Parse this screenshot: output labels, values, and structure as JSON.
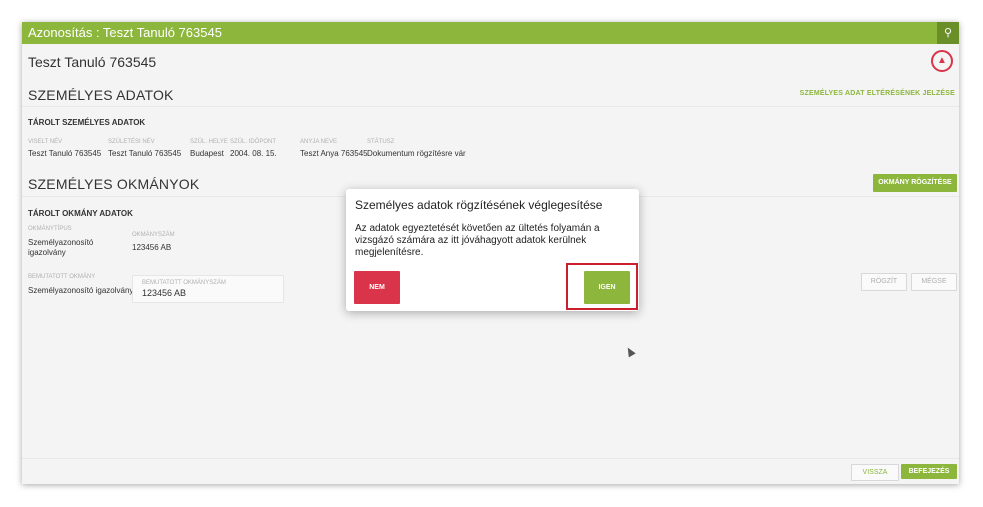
{
  "header": {
    "title": "Azonosítás : Teszt Tanuló 763545",
    "search_icon": "search-icon"
  },
  "student_name": "Teszt Tanuló 763545",
  "personal": {
    "title": "SZEMÉLYES ADATOK",
    "link": "SZEMÉLYES ADAT ELTÉRÉSÉNEK JELZÉSE",
    "stored_title": "TÁROLT SZEMÉLYES ADATOK",
    "columns": [
      "VISELT NÉV",
      "SZÜLETÉSI NÉV",
      "SZÜL. HELYE",
      "SZÜL. IDŐPONT",
      "ANYJA NEVE",
      "STÁTUSZ"
    ],
    "values": [
      "Teszt Tanuló 763545",
      "Teszt Tanuló 763545",
      "Budapest",
      "2004. 08. 15.",
      "Teszt Anya 763545",
      "Dokumentum rögzítésre vár"
    ]
  },
  "documents": {
    "title": "SZEMÉLYES OKMÁNYOK",
    "record_button": "OKMÁNY RÖGZÍTÉSE",
    "stored_title": "TÁROLT OKMÁNY ADATOK",
    "col_type": "OKMÁNYTÍPUS",
    "col_number": "OKMÁNYSZÁM",
    "type_value": "Személyazonosító igazolvány",
    "number_value": "123456 AB",
    "presented_label": "BEMUTATOTT OKMÁNY",
    "presented_value": "Személyazonosító igazolvány",
    "presented_number_label": "BEMUTATOTT OKMÁNYSZÁM",
    "presented_number_value": "123456 AB",
    "save_button": "RÖGZÍT",
    "cancel_button": "MÉGSE"
  },
  "footer": {
    "back_button": "VISSZA",
    "finish_button": "BEFEJEZÉS"
  },
  "modal": {
    "title": "Személyes adatok rögzítésének véglegesítése",
    "text": "Az adatok egyeztetését követően az ültetés folyamán a vizsgázó számára az itt jóváhagyott adatok kerülnek megjelenítésre.",
    "no_button": "NEM",
    "yes_button": "IGEN"
  },
  "colors": {
    "accent": "#8cb63c",
    "danger": "#d9344a",
    "highlight": "#cc1f2e"
  }
}
